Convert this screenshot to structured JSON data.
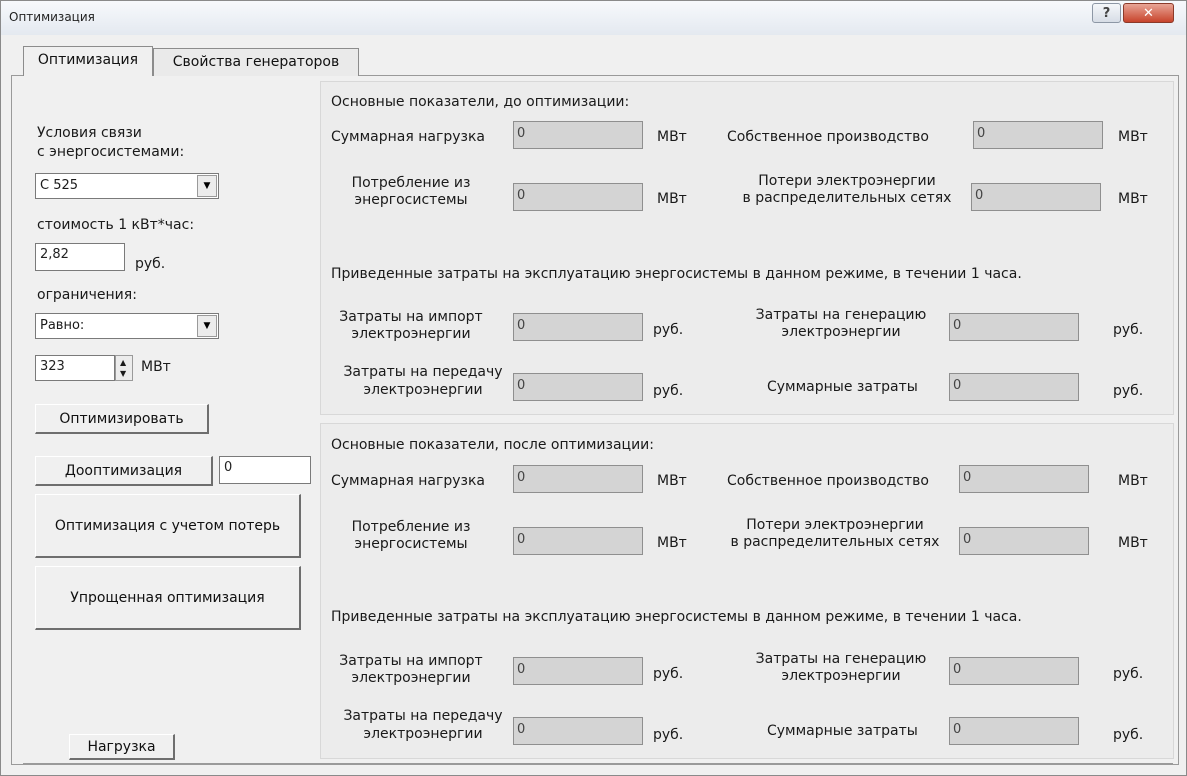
{
  "window": {
    "title": "Оптимизация"
  },
  "tabs": [
    {
      "label": "Оптимизация"
    },
    {
      "label": "Свойства генераторов"
    }
  ],
  "left": {
    "conditions_label": "Условия связи\nс энергосистемами:",
    "conditions_value": "С 525",
    "cost_label": "стоимость 1 кВт*час:",
    "cost_value": "2,82",
    "cost_unit": "руб.",
    "limits_label": "ограничения:",
    "limits_value": "Равно:",
    "limit_amount": "323",
    "limit_unit": "МВт",
    "optimize_label": "Оптимизировать",
    "reoptimize_label": "Дооптимизация",
    "reoptimize_value": "0",
    "optimize_losses_label": "Оптимизация с учетом потерь",
    "simplified_label": "Упрощенная оптимизация",
    "load_label": "Нагрузка"
  },
  "before": {
    "header": "Основные показатели, до оптимизации:",
    "total_load_label": "Суммарная нагрузка",
    "total_load_value": "0",
    "own_production_label": "Собственное производство",
    "own_production_value": "0",
    "consumption_label": "Потребление из\nэнергосистемы",
    "consumption_value": "0",
    "losses_label": "Потери электроэнергии\nв распределительных сетях",
    "losses_value": "0",
    "costs_header": "Приведенные затраты  на эксплуатацию энергосистемы в данном режиме, в течении  1 часа.",
    "import_label": "Затраты на импорт\nэлектроэнергии",
    "import_value": "0",
    "generation_label": "Затраты на генерацию\nэлектроэнергии",
    "generation_value": "0",
    "transfer_label": "Затраты на передачу\nэлектроэнергии",
    "transfer_value": "0",
    "total_costs_label": "Суммарные затраты",
    "total_costs_value": "0"
  },
  "after": {
    "header": "Основные показатели, после оптимизации:",
    "total_load_label": "Суммарная нагрузка",
    "total_load_value": "0",
    "own_production_label": "Собственное производство",
    "own_production_value": "0",
    "consumption_label": "Потребление из\nэнергосистемы",
    "consumption_value": "0",
    "losses_label": "Потери электроэнергии\nв распределительных сетях",
    "losses_value": "0",
    "costs_header": "Приведенные затраты  на эксплуатацию энергосистемы в данном режиме, в течении  1 часа.",
    "import_label": "Затраты на импорт\nэлектроэнергии",
    "import_value": "0",
    "generation_label": "Затраты на генерацию\nэлектроэнергии",
    "generation_value": "0",
    "transfer_label": "Затраты на передачу\nэлектроэнергии",
    "transfer_value": "0",
    "total_costs_label": "Суммарные затраты",
    "total_costs_value": "0"
  },
  "units": {
    "mw": "МВт",
    "rub": "руб."
  }
}
